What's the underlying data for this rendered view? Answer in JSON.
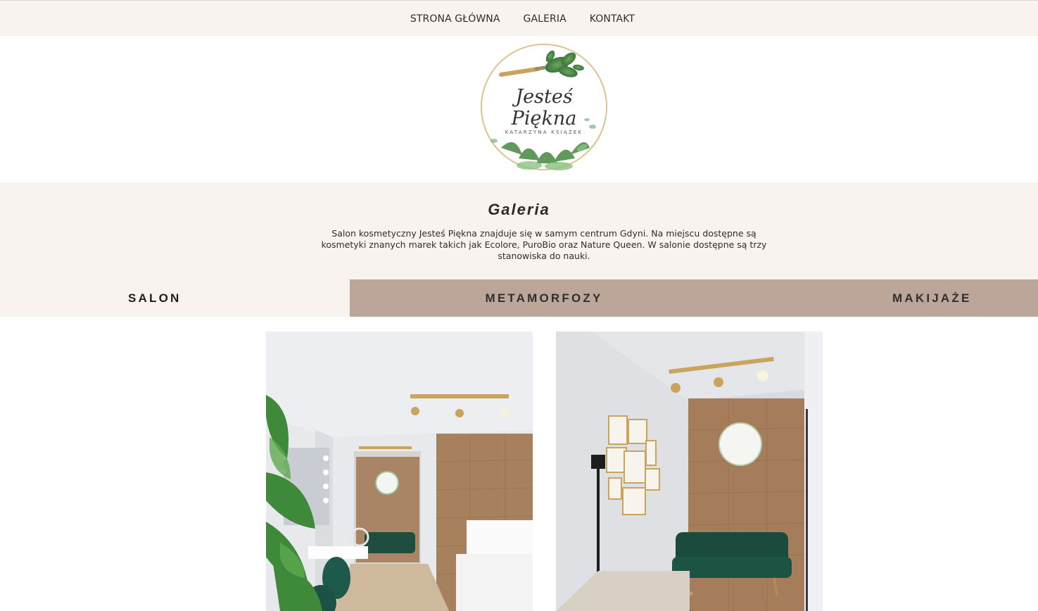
{
  "nav": {
    "items": [
      {
        "label": "STRONA GŁÓWNA"
      },
      {
        "label": "GALERIA"
      },
      {
        "label": "KONTAKT"
      }
    ]
  },
  "logo": {
    "script_text": "Jesteś Piękna",
    "caption": "KATARZYNA KSIĄŻEK"
  },
  "intro": {
    "title": "Galeria",
    "description": "Salon kosmetyczny Jesteś Piękna znajduje się w samym centrum Gdyni. Na miejscu dostępne są kosmetyki znanych marek takich jak Ecolore, PuroBio oraz Nature Queen. W salonie dostępne są trzy stanowiska do nauki."
  },
  "tabs": [
    {
      "label": "SALON",
      "active": true
    },
    {
      "label": "METAMORFOZY",
      "active": false
    },
    {
      "label": "MAKIJAŻE",
      "active": false
    }
  ],
  "colors": {
    "beige_bg": "#f8f3ef",
    "tab_inactive": "#bba699",
    "text_dark": "#2d2d2d"
  },
  "gallery": {
    "photos": [
      {
        "icon": "salon-interior-photo-1"
      },
      {
        "icon": "salon-interior-photo-2"
      }
    ]
  }
}
